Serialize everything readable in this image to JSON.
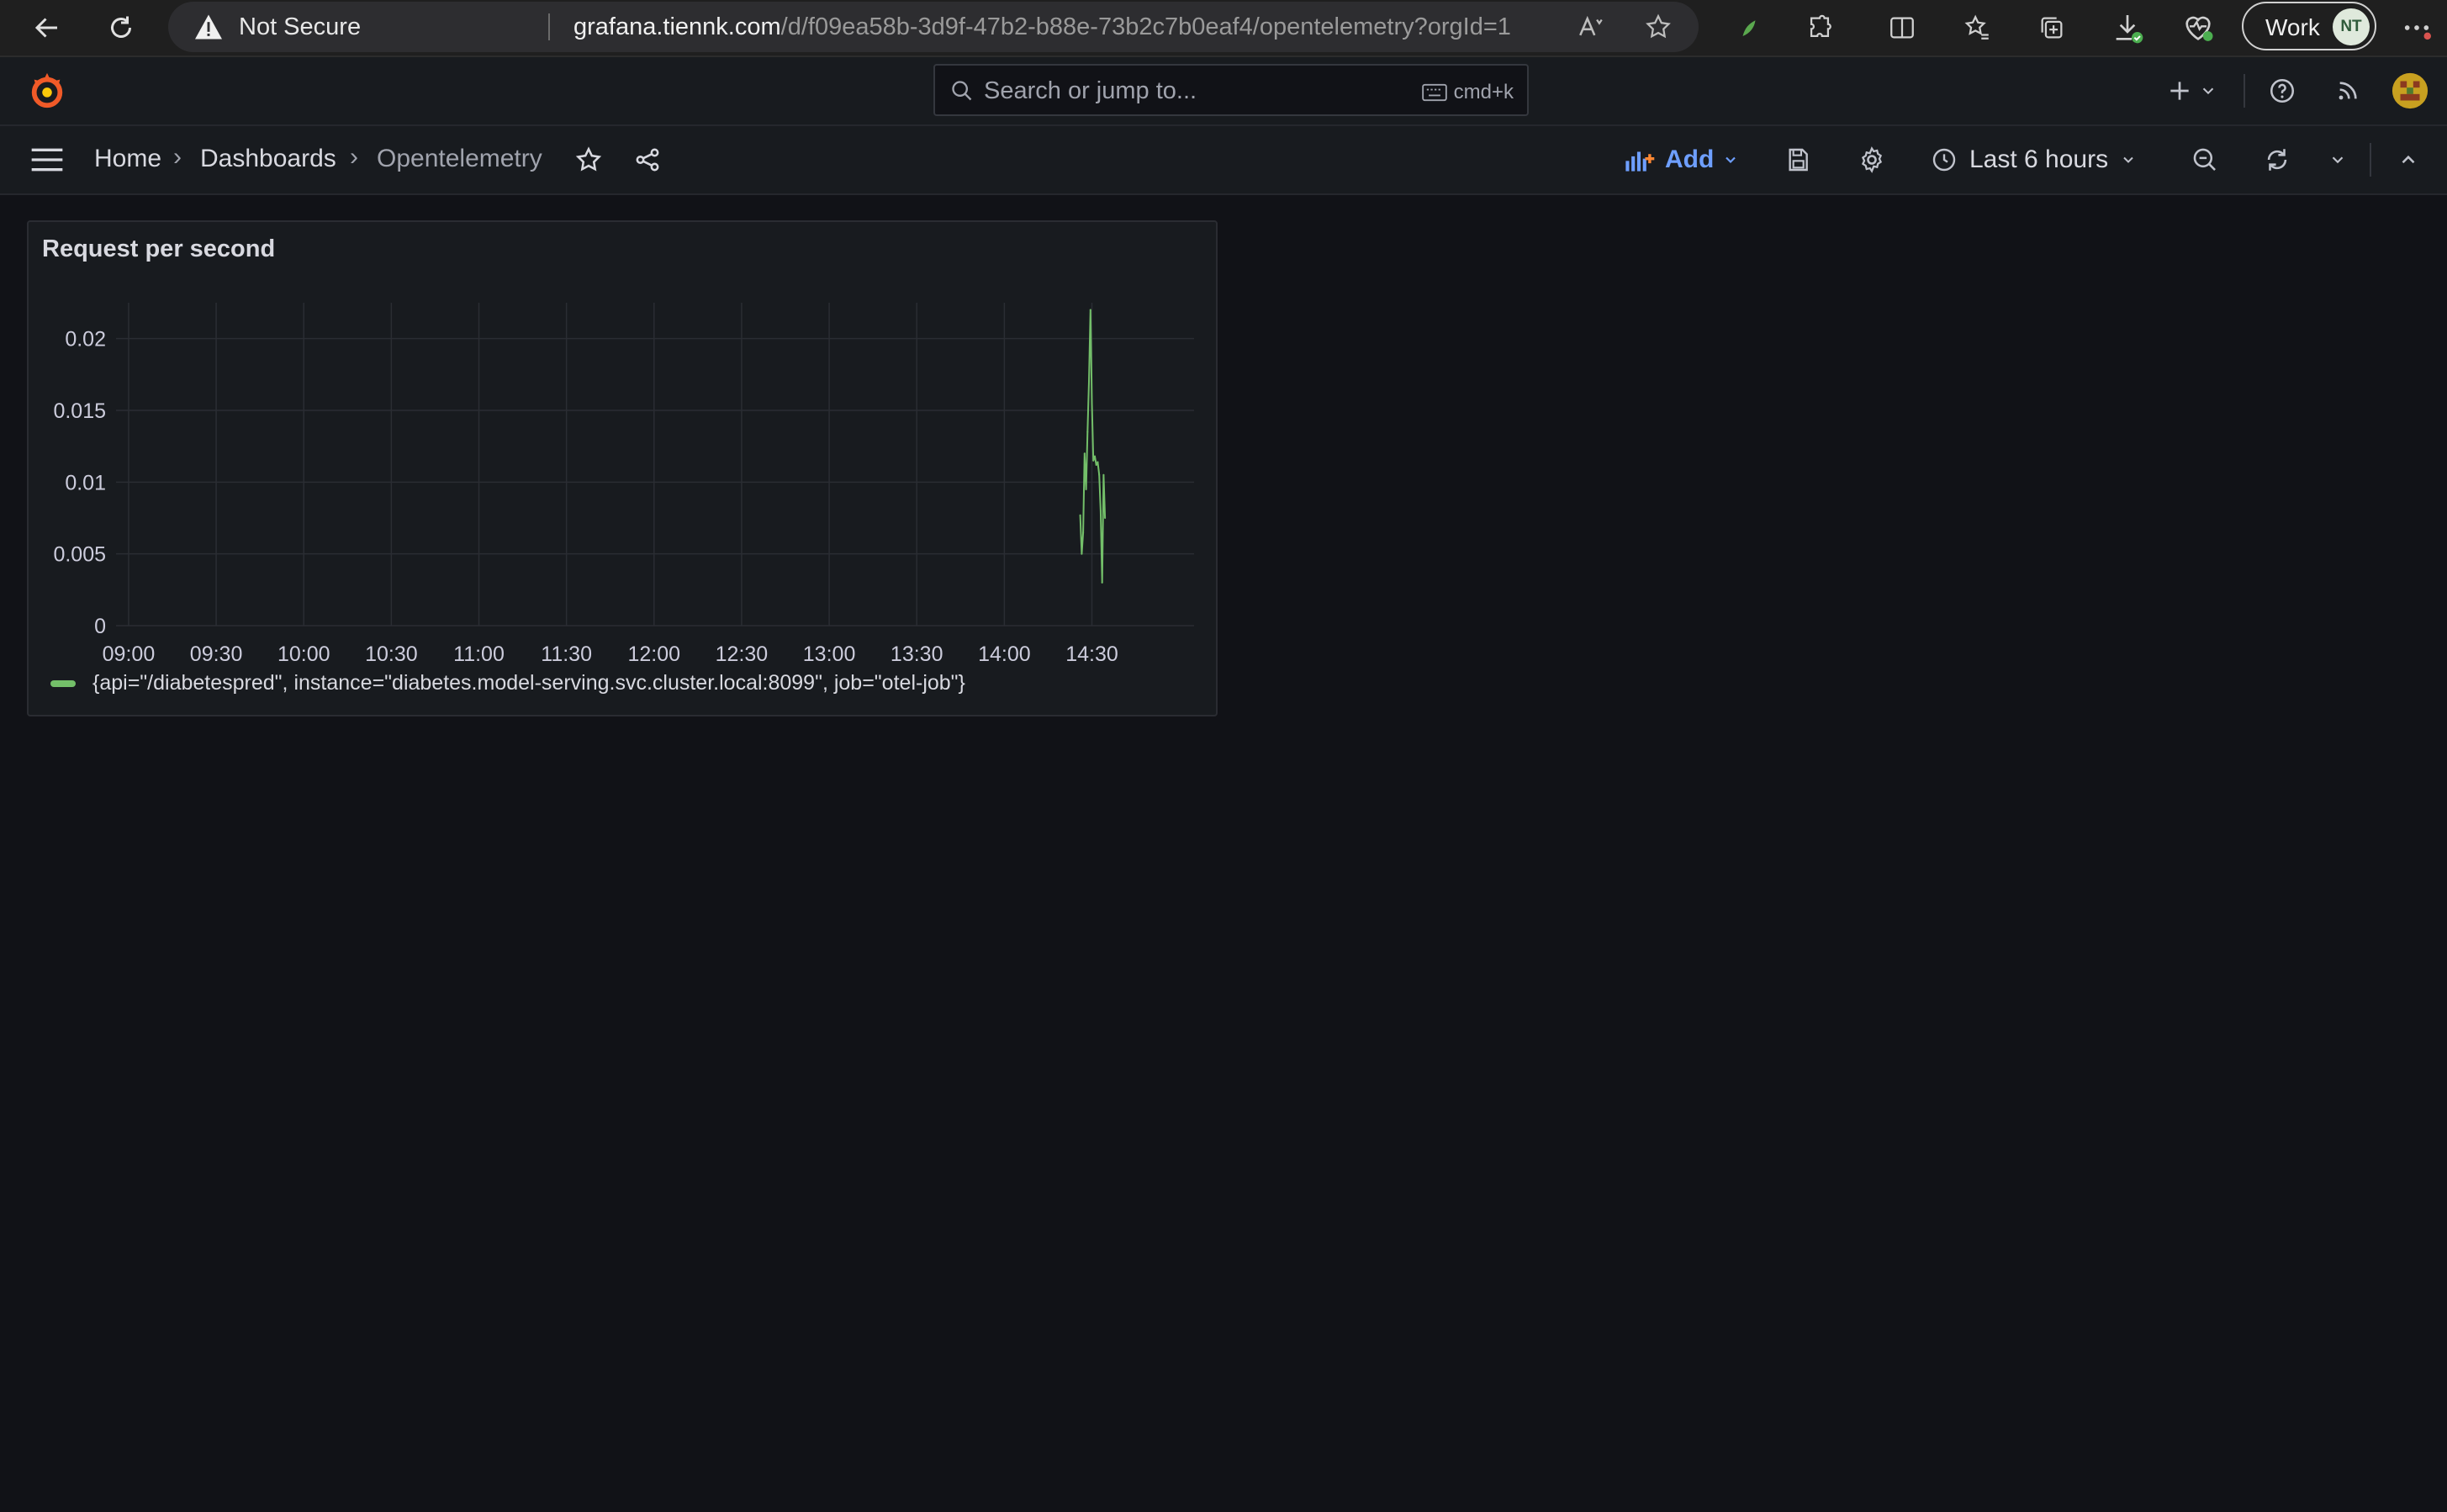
{
  "browser": {
    "security_label": "Not Secure",
    "url_host": "grafana.tiennk.com",
    "url_path": "/d/f09ea58b-3d9f-47b2-b88e-73b2c7b0eaf4/opentelemetry?orgId=1",
    "profile_label": "Work",
    "profile_initials": "NT"
  },
  "topnav": {
    "search_placeholder": "Search or jump to...",
    "search_shortcut": "cmd+k"
  },
  "breadcrumb": {
    "home": "Home",
    "dashboards": "Dashboards",
    "current": "Opentelemetry"
  },
  "toolbar": {
    "add_label": "Add",
    "time_range": "Last 6 hours"
  },
  "colors": {
    "accent": "#6e9fff",
    "series": "#73bf69",
    "background": "#111217",
    "panel": "#181b1f",
    "grafana_orange": "#f05a28"
  },
  "panel": {
    "title": "Request per second"
  },
  "chart_data": {
    "type": "line",
    "title": "Request per second",
    "xlabel": "",
    "ylabel": "",
    "ylim": [
      0,
      0.0225
    ],
    "xlim": [
      "08:58",
      "15:05"
    ],
    "grid": true,
    "legend_position": "bottom-left",
    "x_ticks": [
      "09:00",
      "09:30",
      "10:00",
      "10:30",
      "11:00",
      "11:30",
      "12:00",
      "12:30",
      "13:00",
      "13:30",
      "14:00",
      "14:30"
    ],
    "y_ticks": [
      "0",
      "0.005",
      "0.01",
      "0.015",
      "0.02"
    ],
    "series": [
      {
        "name": "{api=\"/diabetespred\", instance=\"diabetes.model-serving.svc.cluster.local:8099\", job=\"otel-job\"}",
        "color": "#73bf69",
        "x": [
          "14:26",
          "14:26.5",
          "14:27",
          "14:27.5",
          "14:28",
          "14:28.5",
          "14:29",
          "14:29.5",
          "14:30",
          "14:30.5",
          "14:31",
          "14:31.5",
          "14:32",
          "14:32.5",
          "14:33",
          "14:33.5",
          "14:34",
          "14:34.5"
        ],
        "y": [
          0.0077,
          0.005,
          0.0065,
          0.012,
          0.0095,
          0.0135,
          0.017,
          0.022,
          0.0155,
          0.0115,
          0.0118,
          0.0112,
          0.0114,
          0.0105,
          0.008,
          0.003,
          0.0105,
          0.0075
        ]
      }
    ]
  }
}
